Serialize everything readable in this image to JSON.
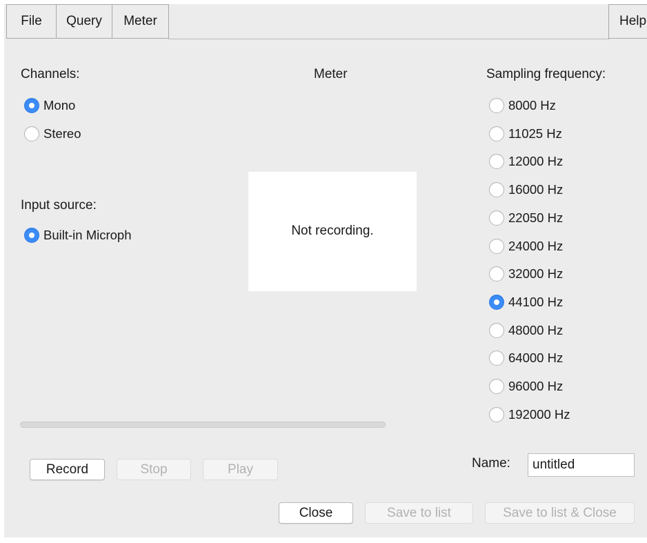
{
  "menu": {
    "file": "File",
    "query": "Query",
    "meter": "Meter",
    "help": "Help"
  },
  "channels": {
    "label": "Channels:",
    "options": [
      {
        "label": "Mono",
        "selected": true
      },
      {
        "label": "Stereo",
        "selected": false
      }
    ]
  },
  "input_source": {
    "label": "Input source:",
    "options": [
      {
        "label": "Built-in Microph",
        "selected": true
      }
    ]
  },
  "meter": {
    "title": "Meter",
    "status": "Not recording."
  },
  "sampling": {
    "label": "Sampling frequency:",
    "options": [
      {
        "label": "8000 Hz",
        "selected": false
      },
      {
        "label": "11025 Hz",
        "selected": false
      },
      {
        "label": "12000 Hz",
        "selected": false
      },
      {
        "label": "16000 Hz",
        "selected": false
      },
      {
        "label": "22050 Hz",
        "selected": false
      },
      {
        "label": "24000 Hz",
        "selected": false
      },
      {
        "label": "32000 Hz",
        "selected": false
      },
      {
        "label": "44100 Hz",
        "selected": true
      },
      {
        "label": "48000 Hz",
        "selected": false
      },
      {
        "label": "64000 Hz",
        "selected": false
      },
      {
        "label": "96000 Hz",
        "selected": false
      },
      {
        "label": "192000 Hz",
        "selected": false
      }
    ]
  },
  "progress": 0,
  "controls": {
    "record": "Record",
    "stop": "Stop",
    "play": "Play"
  },
  "name": {
    "label": "Name:",
    "value": "untitled"
  },
  "footer": {
    "close": "Close",
    "save_to_list": "Save to list",
    "save_to_list_close": "Save to list & Close"
  },
  "colors": {
    "accent": "#3b8cf6",
    "window_bg": "#ececec",
    "disabled_text": "#b2b2b2"
  }
}
